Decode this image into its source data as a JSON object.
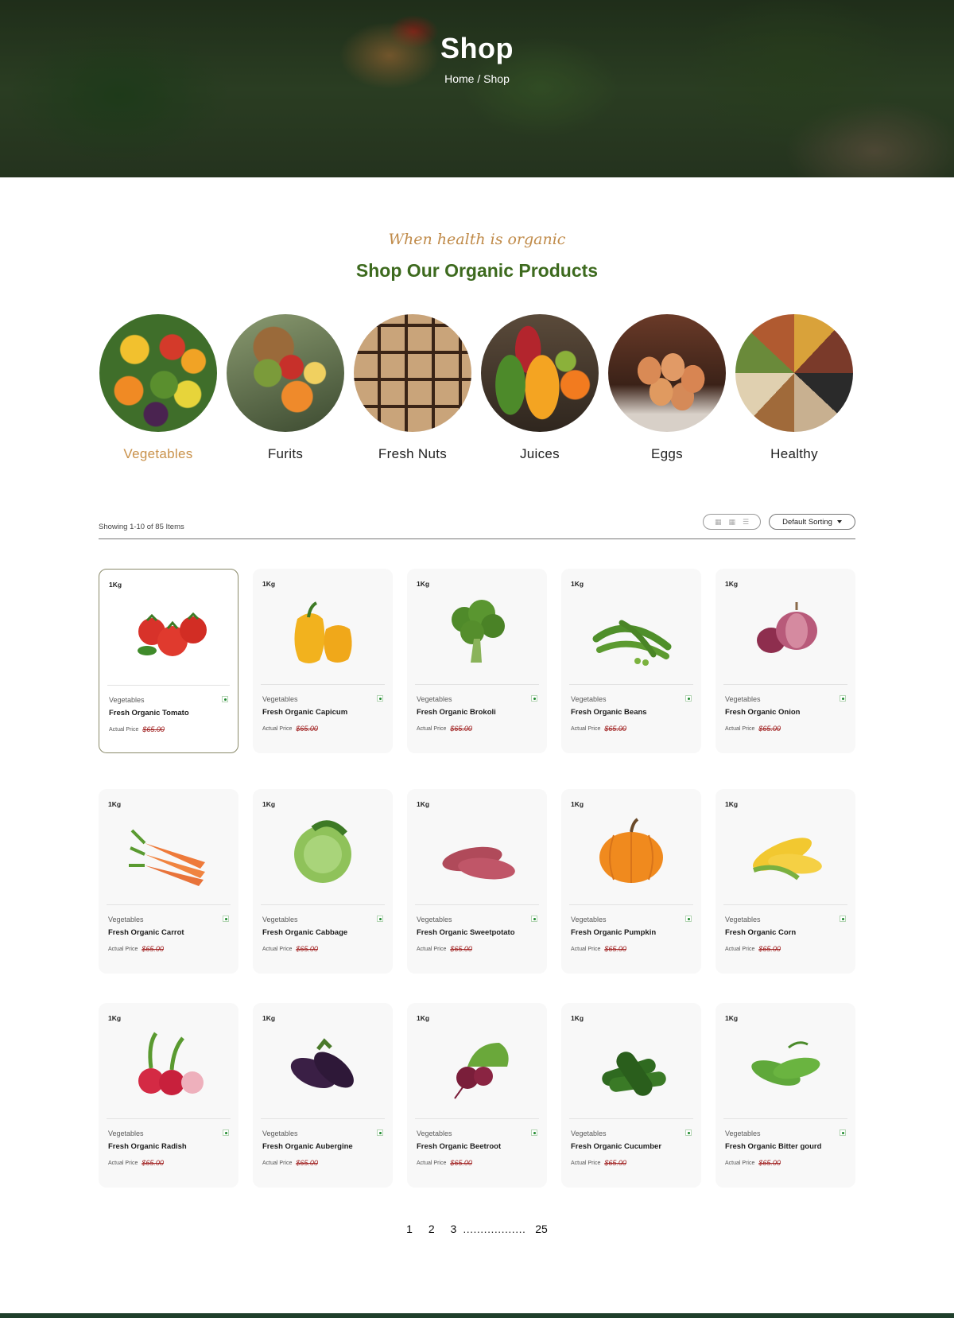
{
  "hero": {
    "title": "Shop",
    "breadcrumb_home": "Home",
    "breadcrumb_sep": "/",
    "breadcrumb_current": "Shop"
  },
  "section": {
    "tagline": "When health is organic",
    "title": "Shop Our Organic Products"
  },
  "categories": [
    {
      "label": "Vegetables",
      "active": true
    },
    {
      "label": "Furits",
      "active": false
    },
    {
      "label": "Fresh Nuts",
      "active": false
    },
    {
      "label": "Juices",
      "active": false
    },
    {
      "label": "Eggs",
      "active": false
    },
    {
      "label": "Healthy",
      "active": false
    }
  ],
  "toolbar": {
    "showing": "Showing 1-10 of 85 Items",
    "sort_label": "Default Sorting"
  },
  "colors": {
    "accent_green": "#3d6a1e",
    "accent_gold": "#c9914a",
    "price_red": "#a02020"
  },
  "products": [
    {
      "weight": "1Kg",
      "category": "Vegetables",
      "name": "Fresh Organic Tomato",
      "price_label": "Actual Price",
      "price": "$65.00",
      "icon": "tomato",
      "selected": true
    },
    {
      "weight": "1Kg",
      "category": "Vegetables",
      "name": "Fresh Organic Capicum",
      "price_label": "Actual Price",
      "price": "$65.00",
      "icon": "capsicum"
    },
    {
      "weight": "1Kg",
      "category": "Vegetables",
      "name": "Fresh Organic Brokoli",
      "price_label": "Actual Price",
      "price": "$65.00",
      "icon": "broccoli"
    },
    {
      "weight": "1Kg",
      "category": "Vegetables",
      "name": "Fresh Organic Beans",
      "price_label": "Actual Price",
      "price": "$65.00",
      "icon": "beans"
    },
    {
      "weight": "1Kg",
      "category": "Vegetables",
      "name": "Fresh Organic Onion",
      "price_label": "Actual Price",
      "price": "$65.00",
      "icon": "onion"
    },
    {
      "weight": "1Kg",
      "category": "Vegetables",
      "name": "Fresh Organic Carrot",
      "price_label": "Actual Price",
      "price": "$65.00",
      "icon": "carrot"
    },
    {
      "weight": "1Kg",
      "category": "Vegetables",
      "name": "Fresh Organic Cabbage",
      "price_label": "Actual Price",
      "price": "$65.00",
      "icon": "cabbage"
    },
    {
      "weight": "1Kg",
      "category": "Vegetables",
      "name": "Fresh Organic Sweetpotato",
      "price_label": "Actual Price",
      "price": "$65.00",
      "icon": "sweetpotato"
    },
    {
      "weight": "1Kg",
      "category": "Vegetables",
      "name": "Fresh Organic Pumpkin",
      "price_label": "Actual Price",
      "price": "$65.00",
      "icon": "pumpkin"
    },
    {
      "weight": "1Kg",
      "category": "Vegetables",
      "name": "Fresh Organic Corn",
      "price_label": "Actual Price",
      "price": "$65.00",
      "icon": "corn"
    },
    {
      "weight": "1Kg",
      "category": "Vegetables",
      "name": "Fresh Organic Radish",
      "price_label": "Actual Price",
      "price": "$65.00",
      "icon": "radish"
    },
    {
      "weight": "1Kg",
      "category": "Vegetables",
      "name": "Fresh Organic Aubergine",
      "price_label": "Actual Price",
      "price": "$65.00",
      "icon": "aubergine"
    },
    {
      "weight": "1Kg",
      "category": "Vegetables",
      "name": "Fresh Organic Beetroot",
      "price_label": "Actual Price",
      "price": "$65.00",
      "icon": "beetroot"
    },
    {
      "weight": "1Kg",
      "category": "Vegetables",
      "name": "Fresh Organic Cucumber",
      "price_label": "Actual Price",
      "price": "$65.00",
      "icon": "cucumber"
    },
    {
      "weight": "1Kg",
      "category": "Vegetables",
      "name": "Fresh Organic Bitter gourd",
      "price_label": "Actual Price",
      "price": "$65.00",
      "icon": "bittergourd"
    }
  ],
  "pagination": {
    "p1": "1",
    "p2": "2",
    "p3": "3",
    "dots": "..................",
    "last": "25"
  }
}
